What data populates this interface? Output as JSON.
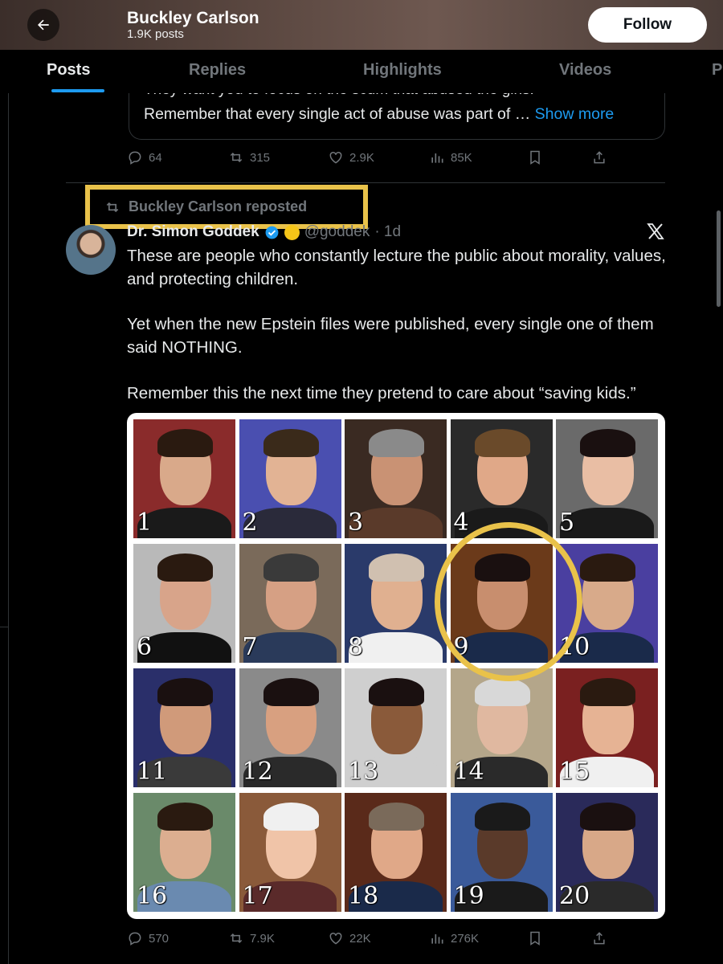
{
  "header": {
    "profile_name": "Buckley Carlson",
    "posts_count": "1.9K posts",
    "follow_label": "Follow"
  },
  "tabs": [
    {
      "label": "Posts",
      "active": true
    },
    {
      "label": "Replies",
      "active": false
    },
    {
      "label": "Highlights",
      "active": false
    },
    {
      "label": "Videos",
      "active": false
    },
    {
      "label": "P",
      "active": false
    }
  ],
  "quoted_post": {
    "line1": "They want you to focus on the scum that abused the girls.",
    "line2": "Remember that every single act of abuse was part of …",
    "show_more": "Show more"
  },
  "previous_post_actions": {
    "replies": "64",
    "reposts": "315",
    "likes": "2.9K",
    "views": "85K"
  },
  "repost": {
    "label": "Buckley Carlson reposted"
  },
  "post": {
    "author_name": "Dr. Simon Goddek",
    "handle": "@goddek",
    "time": "· 1d",
    "paragraphs": [
      "These are people who constantly lecture the public about morality, values, and protecting children.",
      "Yet when the new Epstein files were published, every single one of them said NOTHING.",
      "Remember this the next time they pretend to care about “saving kids.”"
    ],
    "grid_numbers": [
      "1",
      "2",
      "3",
      "4",
      "5",
      "6",
      "7",
      "8",
      "9",
      "10",
      "11",
      "12",
      "13",
      "14",
      "15",
      "16",
      "17",
      "18",
      "19",
      "20"
    ],
    "actions": {
      "replies": "570",
      "reposts": "7.9K",
      "likes": "22K",
      "views": "276K"
    }
  },
  "colors": {
    "accent": "#1d9bf0",
    "highlight": "#e9c24a",
    "muted": "#71767b",
    "background": "#000000"
  }
}
